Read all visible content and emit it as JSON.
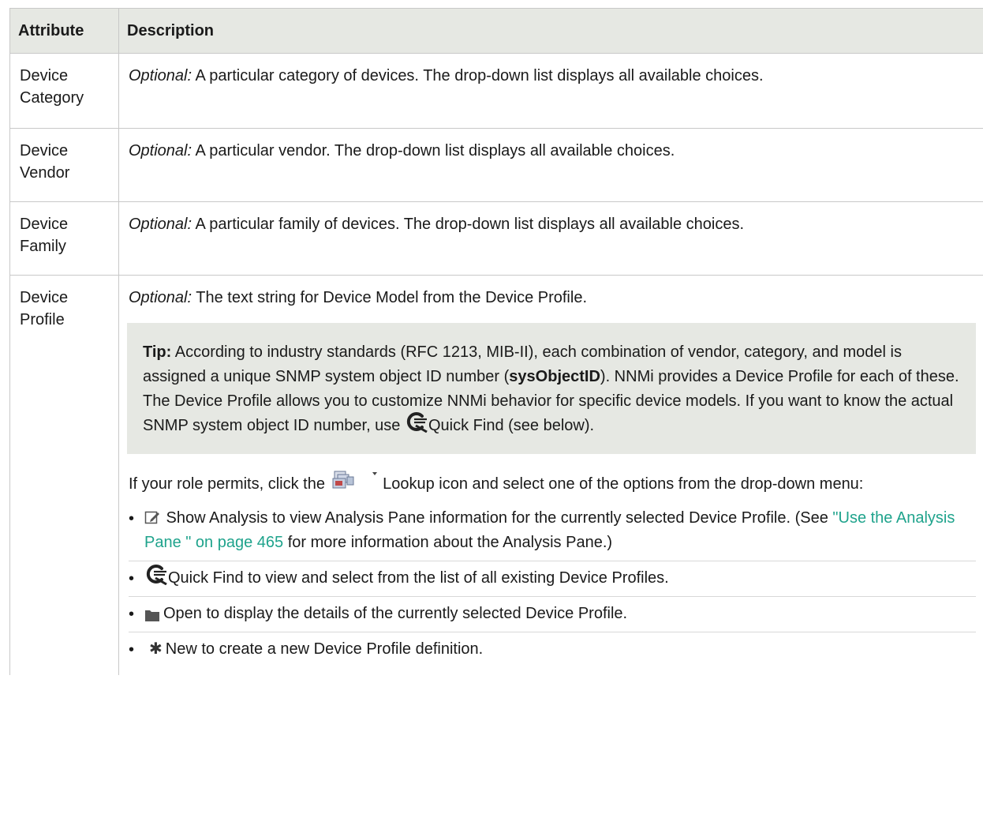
{
  "table": {
    "headers": [
      "Attribute",
      "Description"
    ],
    "rows": [
      {
        "attr_line1": "Device",
        "attr_line2": "Category",
        "desc_label": "Optional:",
        "desc_text": " A particular category of devices. The drop-down list displays all available choices."
      },
      {
        "attr_line1": "Device",
        "attr_line2": "Vendor",
        "desc_label": "Optional:",
        "desc_text": " A particular vendor. The drop-down list displays all available choices."
      },
      {
        "attr_line1": "Device",
        "attr_line2": "Family",
        "desc_label": "Optional:",
        "desc_text": " A particular family of devices. The drop-down list displays all available choices."
      },
      {
        "attr_line1": "Device",
        "attr_line2": "Profile",
        "desc_label": "Optional:",
        "desc_text": " The text string for Device Model from the Device Profile."
      }
    ]
  },
  "tip": {
    "label": "Tip:",
    "text1": " According to industry standards (RFC 1213, MIB-II), each combination of vendor, category, and model is assigned a unique SNMP system object ID number (",
    "bold_term": "sysObjectID",
    "text2": "). NNMi provides a Device Profile for each of these. The Device Profile allows you to customize NNMi behavior for specific device models. If you want to know the actual SNMP system object ID number, use ",
    "text3": "Quick Find (see below)."
  },
  "lookup_para": {
    "before": "If your role permits, click the ",
    "after": " Lookup icon and select one of the options from the drop-down menu:"
  },
  "options": [
    {
      "icon": "edit-icon",
      "before": " Show Analysis to view Analysis Pane information for the currently selected Device Profile. (See ",
      "link": "\"Use the Analysis Pane \" on page 465",
      "after": " for more information about the Analysis Pane.)"
    },
    {
      "icon": "quick-find-icon",
      "text": "Quick Find to view and select from the list of all existing Device Profiles."
    },
    {
      "icon": "folder-icon",
      "text": "Open to display the details of the currently selected Device Profile."
    },
    {
      "icon": "new-star-icon",
      "text": "New to create a new Device Profile definition."
    }
  ],
  "colors": {
    "header_bg": "#e6e8e3",
    "tip_bg": "#e6e8e3",
    "border": "#c8c8c8",
    "link": "#1fa38c",
    "text": "#1a1a1a"
  }
}
